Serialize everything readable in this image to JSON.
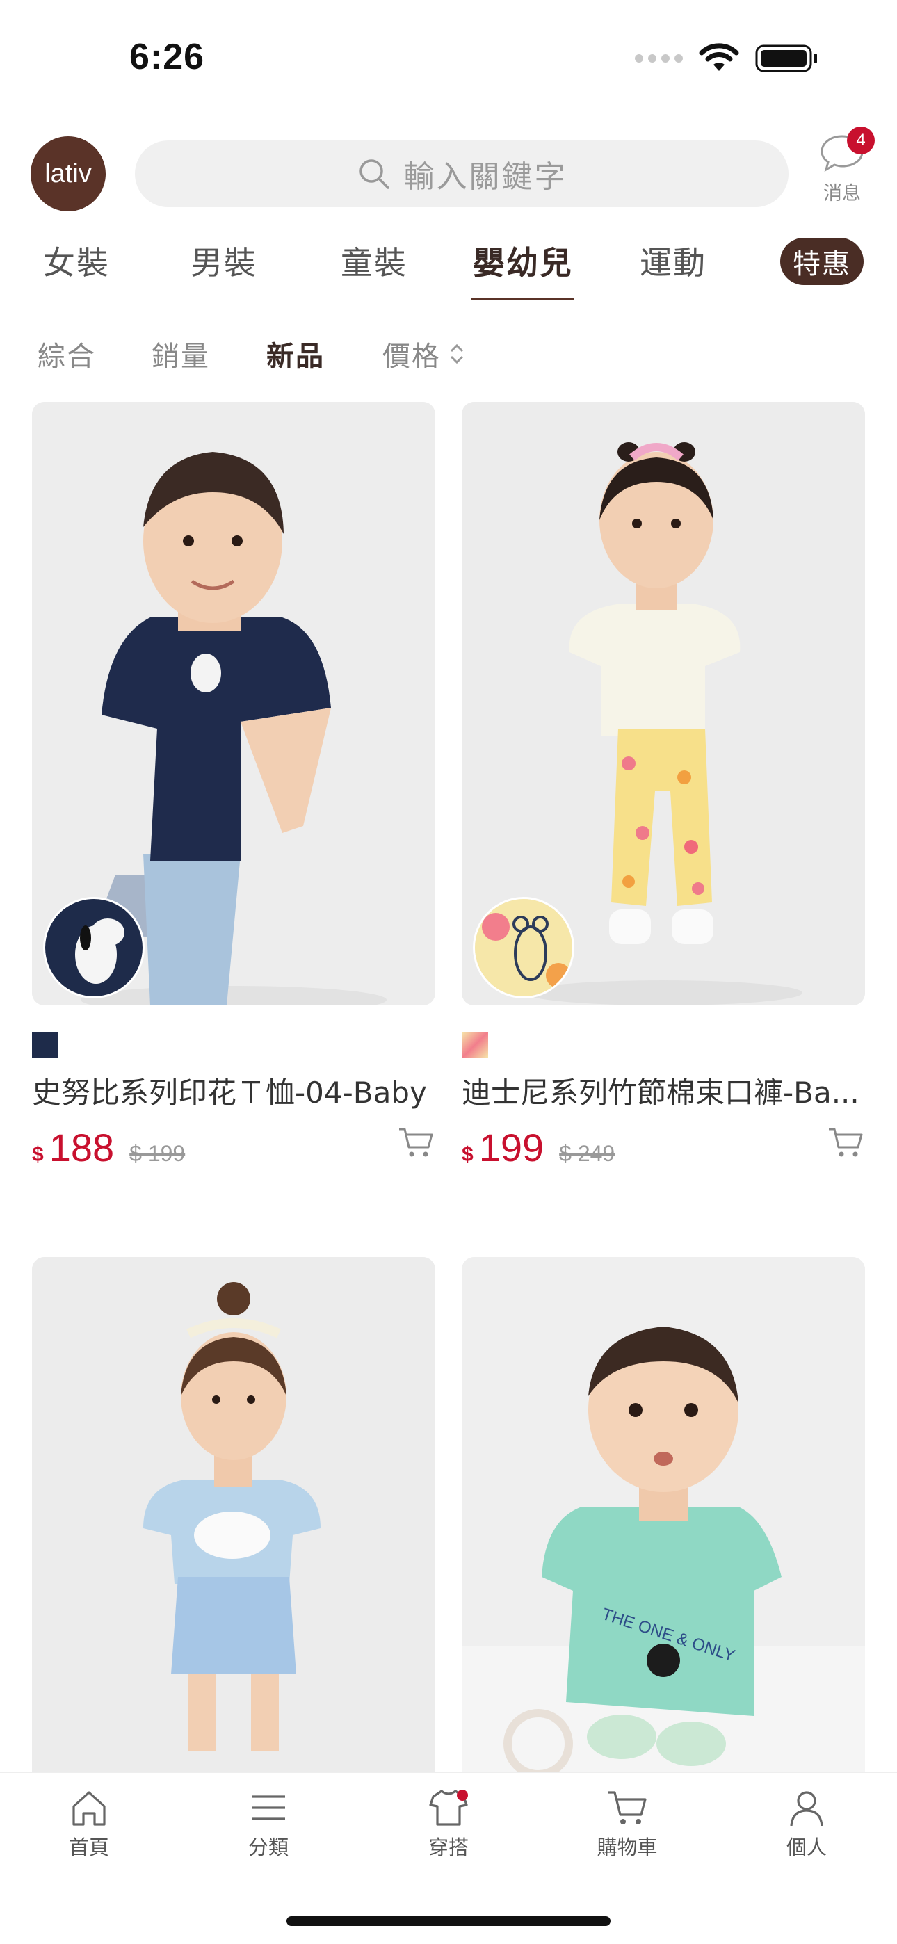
{
  "status_bar": {
    "time": "6:26"
  },
  "header": {
    "logo_text": "lativ",
    "search_placeholder": "輸入關鍵字",
    "messages_label": "消息",
    "messages_badge": "4"
  },
  "categories": {
    "items": [
      {
        "label": "女裝"
      },
      {
        "label": "男裝"
      },
      {
        "label": "童裝"
      },
      {
        "label": "嬰幼兒"
      },
      {
        "label": "運動"
      }
    ],
    "active_index": 3,
    "special_label": "特惠"
  },
  "sort": {
    "items": [
      {
        "label": "綜合"
      },
      {
        "label": "銷量"
      },
      {
        "label": "新品"
      },
      {
        "label": "價格"
      }
    ],
    "active_index": 2
  },
  "products": [
    {
      "name": "史努比系列印花Ｔ恤-04-Baby",
      "currency": "$",
      "price": "188",
      "original_price": "$ 199",
      "swatch_color": "#1e2b4a"
    },
    {
      "name": "迪士尼系列竹節棉束口褲-Ba...",
      "currency": "$",
      "price": "199",
      "original_price": "$ 249",
      "swatch_color": "#f4e6a8"
    },
    {
      "name": "",
      "price": ""
    },
    {
      "name": "",
      "price": ""
    }
  ],
  "bottom_nav": [
    {
      "label": "首頁",
      "icon": "home-icon"
    },
    {
      "label": "分類",
      "icon": "menu-icon"
    },
    {
      "label": "穿搭",
      "icon": "shirt-icon"
    },
    {
      "label": "購物車",
      "icon": "cart-icon"
    },
    {
      "label": "個人",
      "icon": "person-icon"
    }
  ],
  "colors": {
    "brand": "#5a3328",
    "price_red": "#c8102e"
  }
}
